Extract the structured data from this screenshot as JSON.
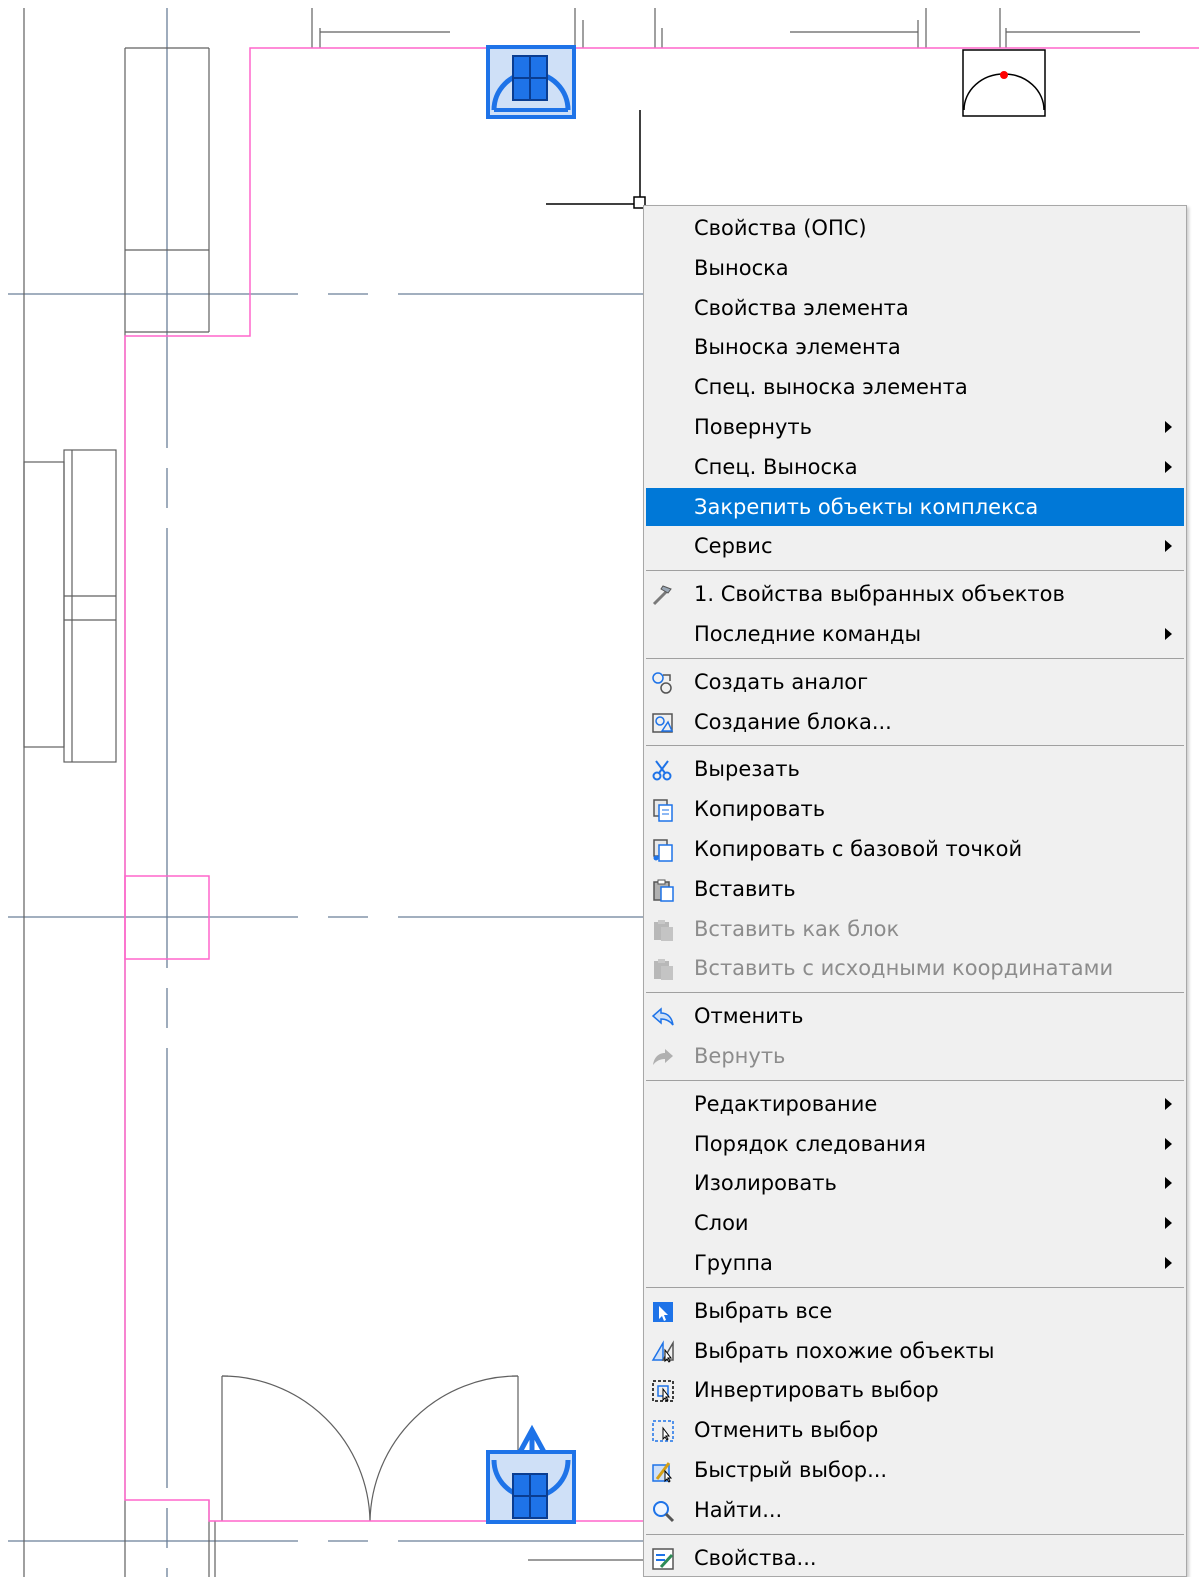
{
  "menu": {
    "items": [
      {
        "label": "Свойства (ОПС)",
        "icon": null,
        "submenu": false,
        "disabled": false,
        "highlighted": false
      },
      {
        "label": "Выноска",
        "icon": null,
        "submenu": false,
        "disabled": false,
        "highlighted": false
      },
      {
        "label": "Свойства элемента",
        "icon": null,
        "submenu": false,
        "disabled": false,
        "highlighted": false
      },
      {
        "label": "Выноска элемента",
        "icon": null,
        "submenu": false,
        "disabled": false,
        "highlighted": false
      },
      {
        "label": "Спец. выноска элемента",
        "icon": null,
        "submenu": false,
        "disabled": false,
        "highlighted": false
      },
      {
        "label": "Повернуть",
        "icon": null,
        "submenu": true,
        "disabled": false,
        "highlighted": false
      },
      {
        "label": "Спец. Выноска",
        "icon": null,
        "submenu": true,
        "disabled": false,
        "highlighted": false
      },
      {
        "label": "Закрепить объекты комплекса",
        "icon": null,
        "submenu": false,
        "disabled": false,
        "highlighted": true
      },
      {
        "label": "Сервис",
        "icon": null,
        "submenu": true,
        "disabled": false,
        "highlighted": false
      },
      {
        "separator": true
      },
      {
        "label": "1. Свойства выбранных объектов",
        "icon": "hammer-icon",
        "submenu": false,
        "disabled": false,
        "highlighted": false
      },
      {
        "label": "Последние команды",
        "icon": null,
        "submenu": true,
        "disabled": false,
        "highlighted": false
      },
      {
        "separator": true
      },
      {
        "label": "Создать аналог",
        "icon": "create-analog-icon",
        "submenu": false,
        "disabled": false,
        "highlighted": false
      },
      {
        "label": "Создание блока...",
        "icon": "block-icon",
        "submenu": false,
        "disabled": false,
        "highlighted": false
      },
      {
        "separator": true
      },
      {
        "label": "Вырезать",
        "icon": "scissors-icon",
        "submenu": false,
        "disabled": false,
        "highlighted": false
      },
      {
        "label": "Копировать",
        "icon": "copy-icon",
        "submenu": false,
        "disabled": false,
        "highlighted": false
      },
      {
        "label": "Копировать с базовой точкой",
        "icon": "copy-base-icon",
        "submenu": false,
        "disabled": false,
        "highlighted": false
      },
      {
        "label": "Вставить",
        "icon": "paste-icon",
        "submenu": false,
        "disabled": false,
        "highlighted": false
      },
      {
        "label": "Вставить как блок",
        "icon": "paste-gray-icon",
        "submenu": false,
        "disabled": true,
        "highlighted": false
      },
      {
        "label": "Вставить с исходными координатами",
        "icon": "paste-gray-icon",
        "submenu": false,
        "disabled": true,
        "highlighted": false
      },
      {
        "separator": true
      },
      {
        "label": "Отменить",
        "icon": "undo-icon",
        "submenu": false,
        "disabled": false,
        "highlighted": false
      },
      {
        "label": "Вернуть",
        "icon": "redo-icon",
        "submenu": false,
        "disabled": true,
        "highlighted": false
      },
      {
        "separator": true
      },
      {
        "label": "Редактирование",
        "icon": null,
        "submenu": true,
        "disabled": false,
        "highlighted": false
      },
      {
        "label": "Порядок следования",
        "icon": null,
        "submenu": true,
        "disabled": false,
        "highlighted": false
      },
      {
        "label": "Изолировать",
        "icon": null,
        "submenu": true,
        "disabled": false,
        "highlighted": false
      },
      {
        "label": "Слои",
        "icon": null,
        "submenu": true,
        "disabled": false,
        "highlighted": false
      },
      {
        "label": "Группа",
        "icon": null,
        "submenu": true,
        "disabled": false,
        "highlighted": false
      },
      {
        "separator": true
      },
      {
        "label": "Выбрать все",
        "icon": "select-all-icon",
        "submenu": false,
        "disabled": false,
        "highlighted": false
      },
      {
        "label": "Выбрать похожие объекты",
        "icon": "select-similar-icon",
        "submenu": false,
        "disabled": false,
        "highlighted": false
      },
      {
        "label": "Инвертировать выбор",
        "icon": "invert-selection-icon",
        "submenu": false,
        "disabled": false,
        "highlighted": false
      },
      {
        "label": "Отменить выбор",
        "icon": "deselect-icon",
        "submenu": false,
        "disabled": false,
        "highlighted": false
      },
      {
        "label": "Быстрый выбор...",
        "icon": "quick-select-icon",
        "submenu": false,
        "disabled": false,
        "highlighted": false
      },
      {
        "label": "Найти...",
        "icon": "magnifier-icon",
        "submenu": false,
        "disabled": false,
        "highlighted": false
      },
      {
        "separator": true
      },
      {
        "label": "Свойства...",
        "icon": "properties-icon",
        "submenu": false,
        "disabled": false,
        "highlighted": false
      }
    ]
  },
  "colors": {
    "highlight": "#0078d7",
    "wall": "#ff66cc",
    "axis": "#6b7f99",
    "grip": "#1e73e8",
    "marker": "#ff0000"
  }
}
